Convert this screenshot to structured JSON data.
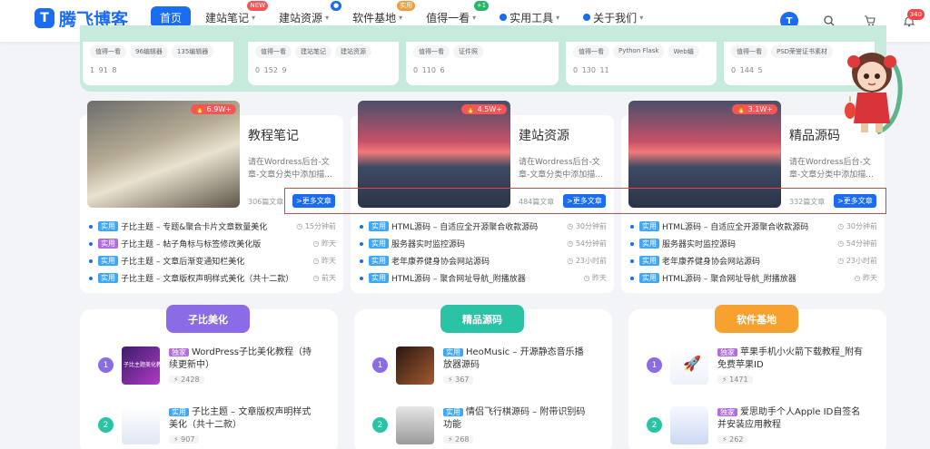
{
  "nav": {
    "logo": "腾飞博客",
    "items": [
      {
        "label": "首页",
        "active": true,
        "badge": ""
      },
      {
        "label": "建站笔记",
        "badge": "NEW",
        "badge_color": "#f25656"
      },
      {
        "label": "建站资源",
        "badge": "●",
        "badge_color": "#1a6cf0"
      },
      {
        "label": "软件基地",
        "badge": "实用",
        "badge_color": "#f29c3d"
      },
      {
        "label": "值得一看",
        "badge": "+1",
        "badge_color": "#28b569"
      },
      {
        "label": "实用工具",
        "badge": ""
      },
      {
        "label": "关于我们",
        "badge": ""
      }
    ],
    "notify_count": "340"
  },
  "top_cards": [
    {
      "tags": [
        "值得一看",
        "96编辑器",
        "135编辑器"
      ],
      "stats": "1  91  8"
    },
    {
      "tags": [
        "值得一看",
        "建站笔记",
        "建站资源"
      ],
      "stats": "0  152  9"
    },
    {
      "tags": [
        "值得一看",
        "证件照"
      ],
      "stats": "0  110  6"
    },
    {
      "tags": [
        "值得一看",
        "Python Flask",
        "Web编"
      ],
      "stats": "0  130  11"
    },
    {
      "tags": [
        "值得一看",
        "PSD荣誉证书素材"
      ],
      "stats": "0  144  5"
    }
  ],
  "categories": [
    {
      "title": "教程笔记",
      "hot": "6.9W+",
      "desc": "请在Wordress后台-文章-文章分类中添加描...",
      "count": "306篇文章",
      "more": ">更多文章",
      "posts": [
        {
          "label": "实用",
          "label_color": "#3fa7f5",
          "text": "子比主题 – 专题&聚合卡片文章数量美化",
          "time": "15分钟前"
        },
        {
          "label": "实用",
          "label_color": "#b06ce0",
          "text": "子比主题 – 帖子角标与标签修改美化版",
          "time": "昨天"
        },
        {
          "label": "实用",
          "label_color": "#3fa7f5",
          "text": "子比主题 – 文章后渐变通知栏美化",
          "time": "昨天"
        },
        {
          "label": "实用",
          "label_color": "#3fa7f5",
          "text": "子比主题 – 文章版权声明样式美化（共十二款）",
          "time": "前天"
        }
      ]
    },
    {
      "title": "建站资源",
      "hot": "4.5W+",
      "desc": "请在Wordress后台-文章-文章分类中添加描...",
      "count": "484篇文章",
      "more": ">更多文章",
      "posts": [
        {
          "label": "实用",
          "label_color": "#3fa7f5",
          "text": "HTML源码 – 自适应全开源聚合收款源码",
          "time": "30分钟前"
        },
        {
          "label": "实用",
          "label_color": "#3fa7f5",
          "text": "服务器实时监控源码",
          "time": "54分钟前"
        },
        {
          "label": "实用",
          "label_color": "#3fa7f5",
          "text": "老年康养健身协会网站源码",
          "time": "23小时前"
        },
        {
          "label": "实用",
          "label_color": "#3fa7f5",
          "text": "HTML源码 – 聚合网址导航_附播放器",
          "time": "昨天"
        }
      ]
    },
    {
      "title": "精品源码",
      "hot": "3.1W+",
      "desc": "请在Wordress后台-文章-文章分类中添加描...",
      "count": "332篇文章",
      "more": ">更多文章",
      "posts": [
        {
          "label": "实用",
          "label_color": "#3fa7f5",
          "text": "HTML源码 – 自适应全开源聚合收款源码",
          "time": "30分钟前"
        },
        {
          "label": "实用",
          "label_color": "#3fa7f5",
          "text": "服务器实时监控源码",
          "time": "54分钟前"
        },
        {
          "label": "实用",
          "label_color": "#3fa7f5",
          "text": "老年康养健身协会网站源码",
          "time": "23小时前"
        },
        {
          "label": "实用",
          "label_color": "#3fa7f5",
          "text": "HTML源码 – 聚合网址导航_附播放器",
          "time": "昨天"
        }
      ]
    }
  ],
  "sections": [
    {
      "title": "子比美化",
      "color": "#8b6be6",
      "items": [
        {
          "num": "1",
          "num_color": "#8b6be6",
          "label": "独家",
          "label_color": "#b06ce0",
          "title": "WordPress子比美化教程（持续更新中）",
          "views": "2428",
          "thumb_text": "子比主题美化教"
        },
        {
          "num": "2",
          "num_color": "#2bc3a6",
          "label": "实用",
          "label_color": "#3fa7f5",
          "title": "子比主题 – 文章版权声明样式美化（共十二款）",
          "views": "907",
          "thumb_text": ""
        }
      ]
    },
    {
      "title": "精品源码",
      "color": "#2bc3a6",
      "items": [
        {
          "num": "1",
          "num_color": "#8b6be6",
          "label": "实用",
          "label_color": "#3fa7f5",
          "title": "HeoMusic – 开源静态音乐播放器源码",
          "views": "367",
          "thumb_text": ""
        },
        {
          "num": "2",
          "num_color": "#2bc3a6",
          "label": "实用",
          "label_color": "#3fa7f5",
          "title": "情侣飞行棋源码 – 附带识别码功能",
          "views": "268",
          "thumb_text": ""
        }
      ]
    },
    {
      "title": "软件基地",
      "color": "#f7a230",
      "items": [
        {
          "num": "1",
          "num_color": "#8b6be6",
          "label": "独家",
          "label_color": "#b06ce0",
          "title": "苹果手机小火箭下载教程_附有免费苹果ID",
          "views": "1471",
          "thumb_text": ""
        },
        {
          "num": "2",
          "num_color": "#2bc3a6",
          "label": "独家",
          "label_color": "#b06ce0",
          "title": "爱思助手个人Apple ID自签名并安装应用教程",
          "views": "262",
          "thumb_text": ""
        }
      ]
    }
  ]
}
